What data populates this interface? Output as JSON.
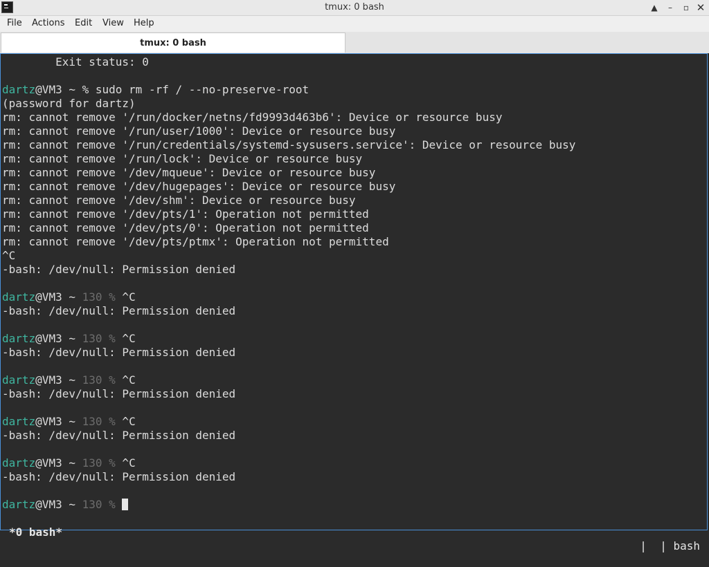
{
  "window": {
    "title": "tmux: 0 bash",
    "buttons": {
      "up": "▲",
      "minimize": "–",
      "maximize": "▫",
      "close": "✕"
    }
  },
  "menu": [
    "File",
    "Actions",
    "Edit",
    "View",
    "Help"
  ],
  "tab": {
    "label": "tmux: 0 bash"
  },
  "colors": {
    "background": "#2b2b2b",
    "text": "#dcdcdc",
    "user": "#3fb6a0",
    "exit_code": "#6d6d6d",
    "focus_border": "#4a90d9"
  },
  "terminal": {
    "exit_status_line": "        Exit status: 0",
    "prompt": {
      "user": "dartz",
      "host_path": "@VM3 ~ ",
      "symbol": "%",
      "code": "130"
    },
    "command": " sudo rm -rf / --no-preserve-root",
    "output": [
      "(password for dartz)",
      "rm: cannot remove '/run/docker/netns/fd9993d463b6': Device or resource busy",
      "rm: cannot remove '/run/user/1000': Device or resource busy",
      "rm: cannot remove '/run/credentials/systemd-sysusers.service': Device or resource busy",
      "rm: cannot remove '/run/lock': Device or resource busy",
      "rm: cannot remove '/dev/mqueue': Device or resource busy",
      "rm: cannot remove '/dev/hugepages': Device or resource busy",
      "rm: cannot remove '/dev/shm': Device or resource busy",
      "rm: cannot remove '/dev/pts/1': Operation not permitted",
      "rm: cannot remove '/dev/pts/0': Operation not permitted",
      "rm: cannot remove '/dev/pts/ptmx': Operation not permitted",
      "^C",
      "-bash: /dev/null: Permission denied"
    ],
    "interrupt": " ^C",
    "denied": "-bash: /dev/null: Permission denied"
  },
  "status": {
    "left": "*0 bash*",
    "right": "|  | bash"
  }
}
